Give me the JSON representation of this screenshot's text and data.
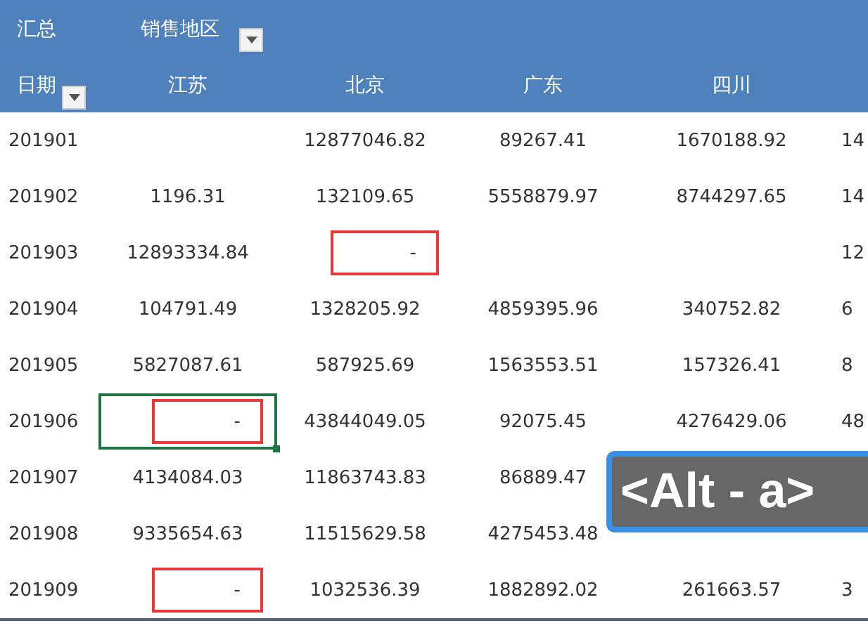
{
  "pivot": {
    "value_label": "汇总",
    "column_field": "销售地区",
    "row_field": "日期",
    "columns": [
      "江苏",
      "北京",
      "广东",
      "四川"
    ],
    "rows": [
      {
        "date": "201901",
        "cells": [
          {},
          {
            "text": "12877046.82",
            "highlighted": false,
            "selected": false
          },
          {
            "text": "89267.41",
            "highlighted": false,
            "selected": false
          },
          {
            "text": "1670188.92",
            "highlighted": false,
            "selected": false
          },
          {
            "text": "14",
            "highlighted": false,
            "selected": false
          }
        ]
      },
      {
        "date": "201902",
        "cells": [
          {
            "text": "1196.31",
            "highlighted": false,
            "selected": false
          },
          {
            "text": "132109.65",
            "highlighted": false,
            "selected": false
          },
          {
            "text": "5558879.97",
            "highlighted": false,
            "selected": false
          },
          {
            "text": "8744297.65",
            "highlighted": false,
            "selected": false
          },
          {
            "text": "14",
            "highlighted": false,
            "selected": false
          }
        ]
      },
      {
        "date": "201903",
        "cells": [
          {
            "text": "12893334.84",
            "highlighted": false,
            "selected": false
          },
          {
            "text": "-",
            "highlighted": true,
            "selected": false
          },
          {},
          {},
          {
            "text": "12",
            "highlighted": false,
            "selected": false
          }
        ]
      },
      {
        "date": "201904",
        "cells": [
          {
            "text": "104791.49",
            "highlighted": false,
            "selected": false
          },
          {
            "text": "1328205.92",
            "highlighted": false,
            "selected": false
          },
          {
            "text": "4859395.96",
            "highlighted": false,
            "selected": false
          },
          {
            "text": "340752.82",
            "highlighted": false,
            "selected": false
          },
          {
            "text": "6",
            "highlighted": false,
            "selected": false
          }
        ]
      },
      {
        "date": "201905",
        "cells": [
          {
            "text": "5827087.61",
            "highlighted": false,
            "selected": false
          },
          {
            "text": "587925.69",
            "highlighted": false,
            "selected": false
          },
          {
            "text": "1563553.51",
            "highlighted": false,
            "selected": false
          },
          {
            "text": "157326.41",
            "highlighted": false,
            "selected": false
          },
          {
            "text": "8",
            "highlighted": false,
            "selected": false
          }
        ]
      },
      {
        "date": "201906",
        "cells": [
          {
            "text": "-",
            "highlighted": true,
            "selected": true
          },
          {
            "text": "43844049.05",
            "highlighted": false,
            "selected": false
          },
          {
            "text": "92075.45",
            "highlighted": false,
            "selected": false
          },
          {
            "text": "4276429.06",
            "highlighted": false,
            "selected": false
          },
          {
            "text": "48",
            "highlighted": false,
            "selected": false
          }
        ]
      },
      {
        "date": "201907",
        "cells": [
          {
            "text": "4134084.03",
            "highlighted": false,
            "selected": false
          },
          {
            "text": "11863743.83",
            "highlighted": false,
            "selected": false
          },
          {
            "text": "86889.47",
            "highlighted": false,
            "selected": false
          },
          {},
          {}
        ]
      },
      {
        "date": "201908",
        "cells": [
          {
            "text": "9335654.63",
            "highlighted": false,
            "selected": false
          },
          {
            "text": "11515629.58",
            "highlighted": false,
            "selected": false
          },
          {
            "text": "4275453.48",
            "highlighted": false,
            "selected": false
          },
          {},
          {}
        ]
      },
      {
        "date": "201909",
        "cells": [
          {
            "text": "-",
            "highlighted": true,
            "selected": false
          },
          {
            "text": "1032536.39",
            "highlighted": false,
            "selected": false
          },
          {
            "text": "1882892.02",
            "highlighted": false,
            "selected": false
          },
          {
            "text": "261663.57",
            "highlighted": false,
            "selected": false
          },
          {
            "text": "3",
            "highlighted": false,
            "selected": false
          }
        ]
      }
    ]
  },
  "keystroke_overlay": {
    "text": "<Alt - a>"
  }
}
